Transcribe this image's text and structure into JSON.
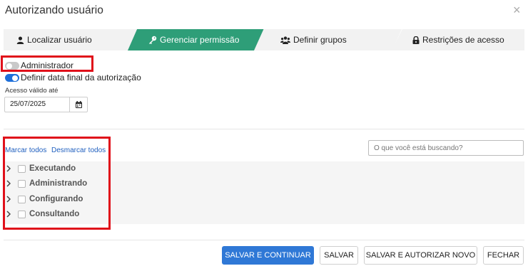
{
  "dialog": {
    "title": "Autorizando usuário",
    "close_glyph": "×"
  },
  "tabs": [
    {
      "label": "Localizar usuário",
      "icon": "user-icon",
      "active": false
    },
    {
      "label": "Gerenciar permissão",
      "icon": "key-icon",
      "active": true
    },
    {
      "label": "Definir grupos",
      "icon": "users-icon",
      "active": false
    },
    {
      "label": "Restrições de acesso",
      "icon": "lock-icon",
      "active": false
    }
  ],
  "colors": {
    "active_tab": "#2e9e78",
    "primary_button": "#2f78d6",
    "toggle_on": "#1e6fd9",
    "highlight": "#e0101a",
    "link": "#1f5fbf"
  },
  "settings": {
    "admin_label": "Administrador",
    "admin_on": false,
    "final_date_label": "Definir data final da autorização",
    "final_date_on": true,
    "valid_until_label": "Acesso válido até",
    "valid_until_value": "25/07/2025"
  },
  "permissions": {
    "select_all": "Marcar todos",
    "deselect_all": "Desmarcar todos",
    "search_placeholder": "O que você está buscando?",
    "items": [
      {
        "label": "Executando",
        "checked": false
      },
      {
        "label": "Administrando",
        "checked": false
      },
      {
        "label": "Configurando",
        "checked": false
      },
      {
        "label": "Consultando",
        "checked": false
      }
    ]
  },
  "footer": {
    "save_continue": "SALVAR E CONTINUAR",
    "save": "SALVAR",
    "save_authorize_new": "SALVAR E AUTORIZAR NOVO",
    "close": "FECHAR"
  }
}
